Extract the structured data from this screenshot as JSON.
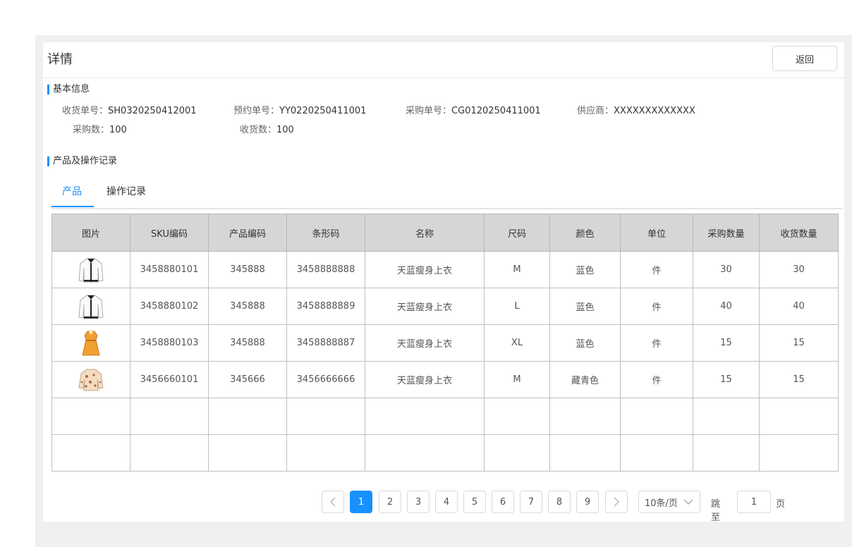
{
  "page": {
    "title": "详情",
    "back_label": "返回"
  },
  "basic_info": {
    "section_title": "基本信息",
    "fields": [
      {
        "label": "收货单号：",
        "value": "SH0320250412001"
      },
      {
        "label": "预约单号：",
        "value": "YY0220250411001"
      },
      {
        "label": "采购单号：",
        "value": "CG0120250411001"
      },
      {
        "label": "供应商：",
        "value": "XXXXXXXXXXXXX"
      },
      {
        "label": "采购数：",
        "value": "100"
      },
      {
        "label": "收货数：",
        "value": "100"
      }
    ]
  },
  "records": {
    "section_title": "产品及操作记录",
    "tabs": [
      {
        "label": "产品"
      },
      {
        "label": "操作记录"
      }
    ],
    "active_tab": "产品"
  },
  "table": {
    "headers": [
      "图片",
      "SKU编码",
      "产品编码",
      "条形码",
      "名称",
      "尺码",
      "颜色",
      "单位",
      "采购数量",
      "收货数量"
    ],
    "rows": [
      {
        "image": "white-cardigan-icon",
        "sku": "3458880101",
        "product_code": "345888",
        "barcode": "3458888888",
        "name": "天蓝瘦身上衣",
        "size": "M",
        "color": "蓝色",
        "unit": "件",
        "purchase_qty": "30",
        "received_qty": "30"
      },
      {
        "image": "white-cardigan-icon",
        "sku": "3458880102",
        "product_code": "345888",
        "barcode": "3458888889",
        "name": "天蓝瘦身上衣",
        "size": "L",
        "color": "蓝色",
        "unit": "件",
        "purchase_qty": "40",
        "received_qty": "40"
      },
      {
        "image": "orange-dress-icon",
        "sku": "3458880103",
        "product_code": "345888",
        "barcode": "3458888887",
        "name": "天蓝瘦身上衣",
        "size": "XL",
        "color": "蓝色",
        "unit": "件",
        "purchase_qty": "15",
        "received_qty": "15"
      },
      {
        "image": "floral-blouse-icon",
        "sku": "3456660101",
        "product_code": "345666",
        "barcode": "3456666666",
        "name": "天蓝瘦身上衣",
        "size": "M",
        "color": "藏青色",
        "unit": "件",
        "purchase_qty": "15",
        "received_qty": "15"
      }
    ],
    "empty_rows": 2
  },
  "pagination": {
    "pages": [
      "1",
      "2",
      "3",
      "4",
      "5",
      "6",
      "7",
      "8",
      "9"
    ],
    "current": "1",
    "page_size": "10条/页",
    "jump_label": "跳至",
    "jump_value": "1",
    "jump_suffix": "页"
  },
  "colors": {
    "accent": "#1890ff",
    "header_bg": "#d6d6d6",
    "page_bg": "#f0f0f0"
  }
}
